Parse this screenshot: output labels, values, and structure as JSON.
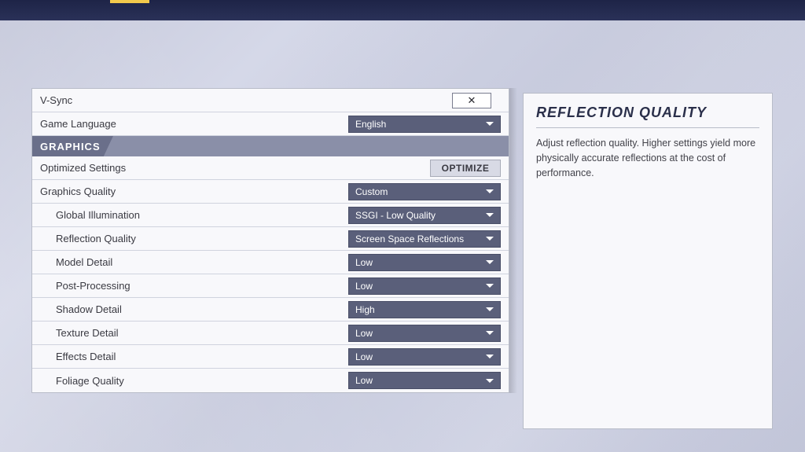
{
  "settings": {
    "vsync": {
      "label": "V-Sync",
      "checked_glyph": "✕"
    },
    "language": {
      "label": "Game Language",
      "value": "English"
    },
    "section_graphics": "GRAPHICS",
    "optimized": {
      "label": "Optimized Settings",
      "button": "OPTIMIZE"
    },
    "quality": {
      "label": "Graphics Quality",
      "value": "Custom"
    },
    "gi": {
      "label": "Global Illumination",
      "value": "SSGI - Low Quality"
    },
    "reflection": {
      "label": "Reflection Quality",
      "value": "Screen Space Reflections"
    },
    "model": {
      "label": "Model Detail",
      "value": "Low"
    },
    "post": {
      "label": "Post-Processing",
      "value": "Low"
    },
    "shadow": {
      "label": "Shadow Detail",
      "value": "High"
    },
    "texture": {
      "label": "Texture Detail",
      "value": "Low"
    },
    "effects": {
      "label": "Effects Detail",
      "value": "Low"
    },
    "foliage": {
      "label": "Foliage Quality",
      "value": "Low"
    }
  },
  "detail": {
    "title": "REFLECTION QUALITY",
    "description": "Adjust reflection quality. Higher settings yield more physically accurate reflections at the cost of performance."
  }
}
